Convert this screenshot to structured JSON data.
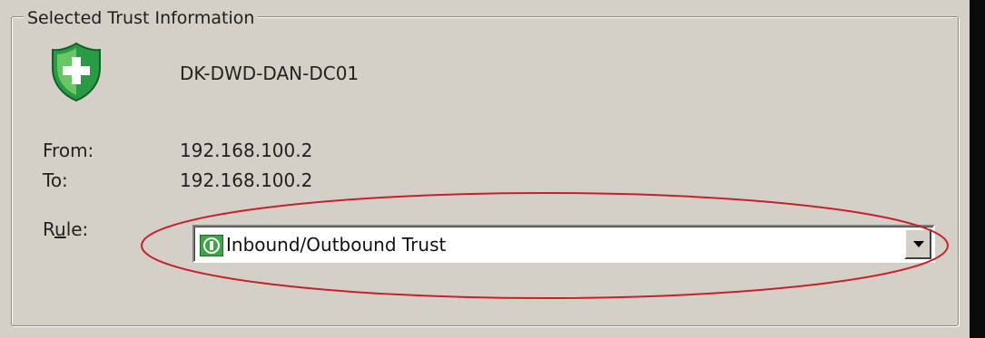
{
  "groupbox": {
    "title": "Selected Trust Information"
  },
  "trust": {
    "icon": "shield-plus-icon",
    "server_name": "DK-DWD-DAN-DC01",
    "from_label": "From:",
    "from_value": "192.168.100.2",
    "to_label": "To:",
    "to_value": "192.168.100.2",
    "rule_label_prefix": "R",
    "rule_label_underlined": "u",
    "rule_label_suffix": "le:",
    "rule_value": "Inbound/Outbound Trust",
    "rule_icon": "inbound-outbound-trust-icon"
  },
  "colors": {
    "panel_bg": "#d4d0c8",
    "shield_green": "#2fa84a",
    "annotation_red": "#c8202a"
  }
}
